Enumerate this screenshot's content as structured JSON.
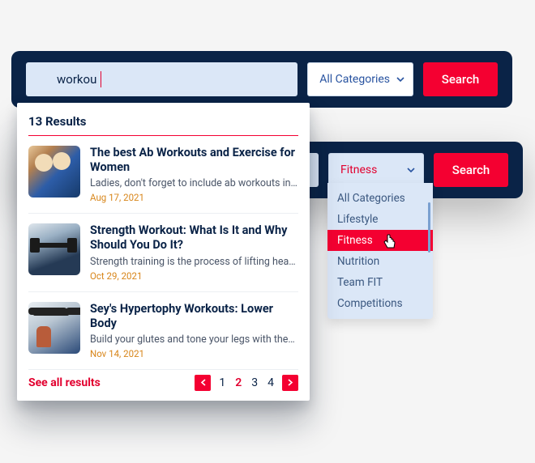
{
  "colors": {
    "navy": "#0a2347",
    "pale": "#dbe7f7",
    "red": "#f40031",
    "blue_text": "#2853a0"
  },
  "front_bar": {
    "search_value": "workou",
    "category_label": "All Categories",
    "search_button": "Search"
  },
  "back_bar": {
    "category_label": "Fitness",
    "search_button": "Search",
    "dropdown_options": [
      "All Categories",
      "Lifestyle",
      "Fitness",
      "Nutrition",
      "Team FIT",
      "Competitions"
    ],
    "selected_option": "Fitness"
  },
  "results": {
    "header": "13 Results",
    "see_all": "See all results",
    "pages": [
      "1",
      "2",
      "3",
      "4"
    ],
    "current_page": "2",
    "items": [
      {
        "title": "The best Ab Workouts and Exercise for Women",
        "snippet": "Ladies, don't forget to include ab workouts in ...",
        "date": "Aug 17, 2021"
      },
      {
        "title": "Strength Workout: What Is It and Why Should You Do It?",
        "snippet": "Strength training is the process of lifting heavy...",
        "date": "Oct 29, 2021"
      },
      {
        "title": "Sey's Hypertophy Workouts: Lower Body",
        "snippet": "Build your glutes and tone your legs with thes...",
        "date": "Nov 14, 2021"
      }
    ]
  }
}
